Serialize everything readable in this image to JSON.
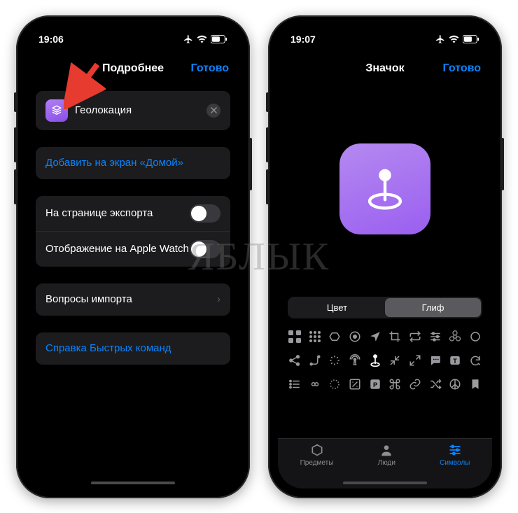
{
  "watermark": "ЯБЛЫК",
  "left": {
    "status_time": "19:06",
    "nav_title": "Подробнее",
    "nav_done": "Готово",
    "shortcut_name": "Геолокация",
    "add_home": "Добавить на экран «Домой»",
    "show_export": "На странице экспорта",
    "show_watch": "Отображение на Apple Watch",
    "import_q": "Вопросы импорта",
    "help": "Справка Быстрых команд"
  },
  "right": {
    "status_time": "19:07",
    "nav_title": "Значок",
    "nav_done": "Готово",
    "seg_color": "Цвет",
    "seg_glyph": "Глиф",
    "tab_objects": "Предметы",
    "tab_people": "Люди",
    "tab_symbols": "Символы"
  }
}
